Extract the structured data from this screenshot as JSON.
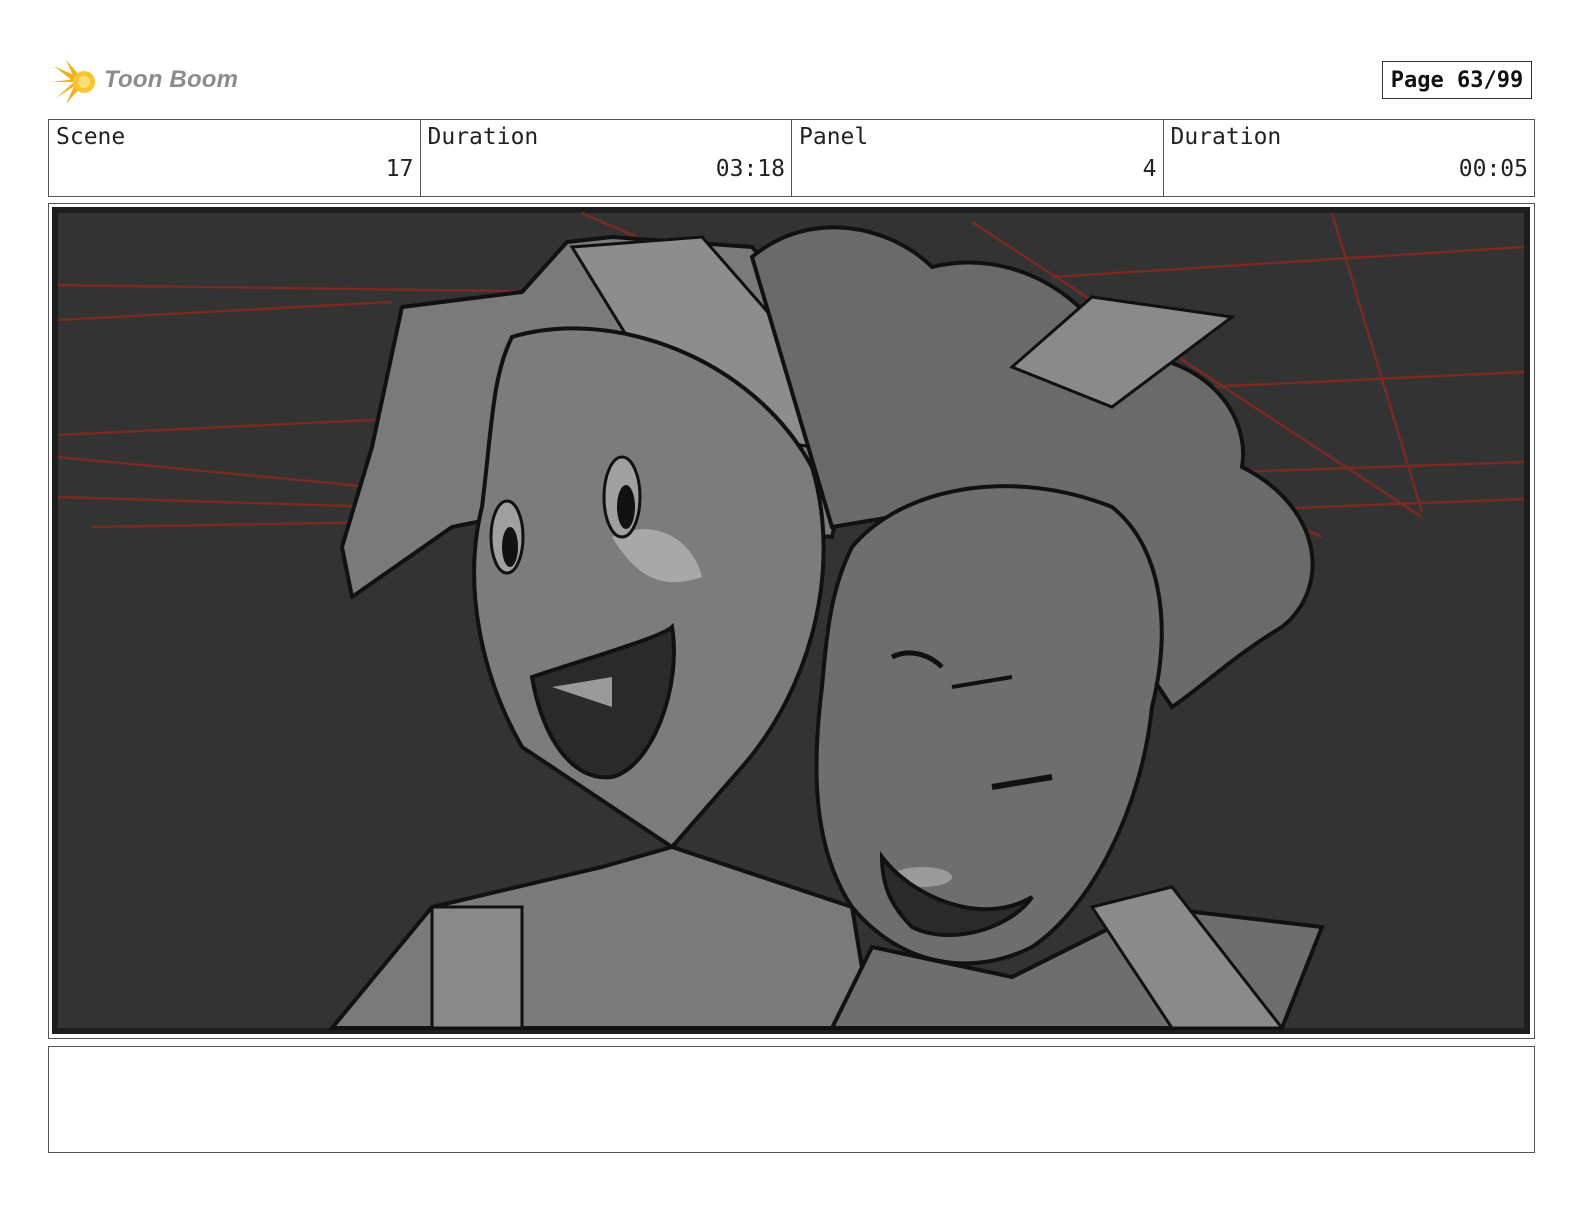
{
  "header": {
    "logo_text": "Toon Boom",
    "logo_icon": "starburst-icon",
    "page_label": "Page 63/99"
  },
  "info": {
    "scene_label": "Scene",
    "scene_value": "17",
    "scene_duration_label": "Duration",
    "scene_duration_value": "03:18",
    "panel_label": "Panel",
    "panel_value": "4",
    "panel_duration_label": "Duration",
    "panel_duration_value": "00:05"
  },
  "panel": {
    "illustration": "storyboard-sketch",
    "colors": {
      "background": "#333333",
      "perspective_lines": "#7a2a22",
      "skin": "#7c7c7c",
      "hair": "#6a6a6a",
      "highlight": "#a8a8a8",
      "ink": "#111111"
    }
  },
  "notes": {
    "text": ""
  }
}
